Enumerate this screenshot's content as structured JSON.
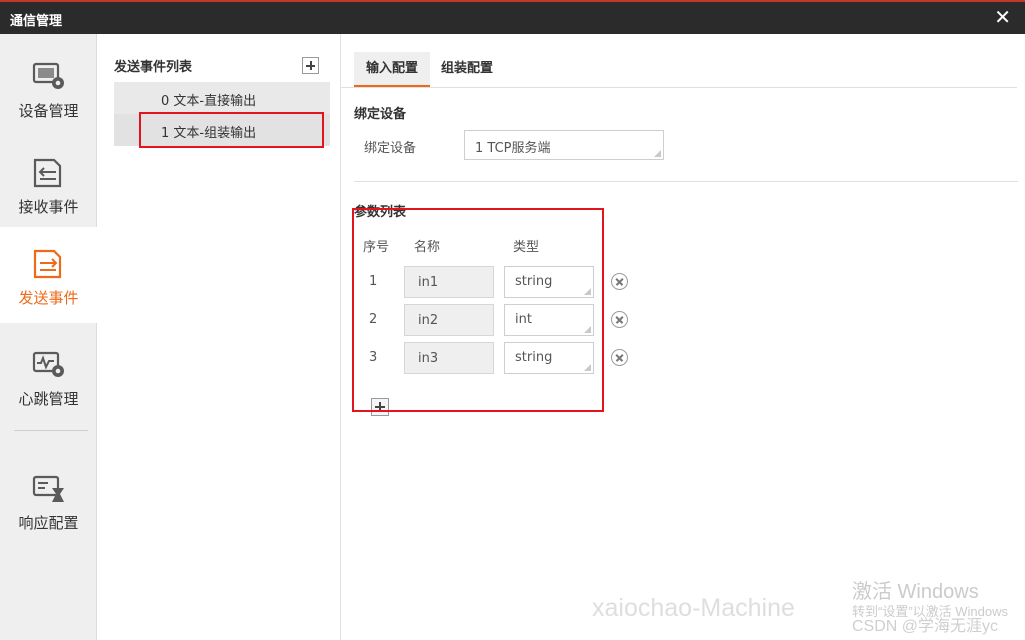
{
  "window": {
    "title": "通信管理",
    "close_symbol": "✕"
  },
  "sidebar": {
    "items": [
      {
        "label": "设备管理",
        "icon": "device-settings-icon",
        "active": false
      },
      {
        "label": "接收事件",
        "icon": "receive-event-icon",
        "active": false
      },
      {
        "label": "发送事件",
        "icon": "send-event-icon",
        "active": true
      },
      {
        "label": "心跳管理",
        "icon": "heartbeat-icon",
        "active": false
      },
      {
        "label": "响应配置",
        "icon": "response-config-icon",
        "active": false
      }
    ]
  },
  "event_panel": {
    "header": "发送事件列表",
    "events": [
      {
        "label": "0 文本-直接输出",
        "selected": false
      },
      {
        "label": "1 文本-组装输出",
        "selected": true
      }
    ]
  },
  "main": {
    "tabs": [
      {
        "label": "输入配置",
        "active": true
      },
      {
        "label": "组装配置",
        "active": false
      }
    ],
    "bind_section": {
      "title": "绑定设备",
      "field_label": "绑定设备",
      "value": "1 TCP服务端"
    },
    "params": {
      "title": "参数列表",
      "headers": {
        "index": "序号",
        "name": "名称",
        "type": "类型"
      },
      "rows": [
        {
          "index": "1",
          "name": "in1",
          "type": "string"
        },
        {
          "index": "2",
          "name": "in2",
          "type": "int"
        },
        {
          "index": "3",
          "name": "in3",
          "type": "string"
        }
      ]
    }
  },
  "watermarks": {
    "activate_title": "激活 Windows",
    "activate_sub": "转到“设置”以激活 Windows",
    "machine": "xaiochao-Machine",
    "csdn": "CSDN @学海无涯yc"
  },
  "colors": {
    "accent": "#ee6a1b",
    "highlight_box": "#e3141e",
    "titlebar": "#2b2b2b"
  }
}
